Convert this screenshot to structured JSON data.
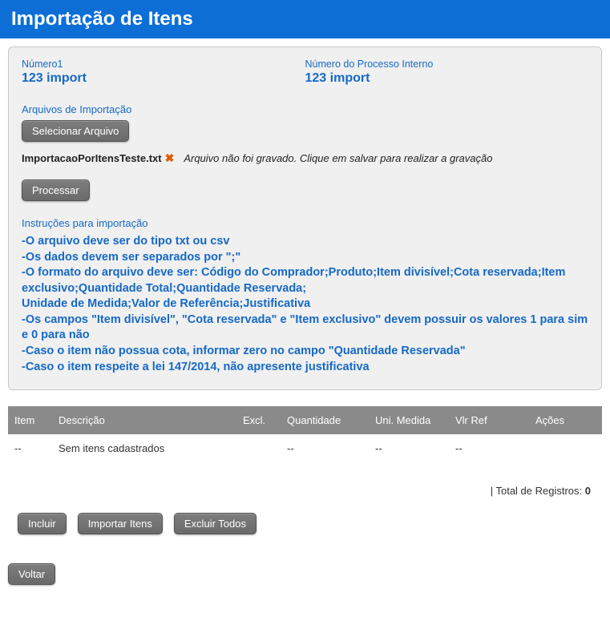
{
  "header": {
    "title": "Importação de Itens"
  },
  "fields": {
    "numero1": {
      "label": "Número1",
      "value": "123 import"
    },
    "numeroProcesso": {
      "label": "Número do Processo Interno",
      "value": "123 import"
    }
  },
  "upload": {
    "sectionLabel": "Arquivos de Importação",
    "selectButton": "Selecionar Arquivo",
    "fileName": "ImportacaoPorItensTeste.txt",
    "deleteIconName": "delete-icon",
    "notSavedMessage": "Arquivo não foi gravado. Clique em salvar para realizar a gravação",
    "processButton": "Processar"
  },
  "instructions": {
    "title": "Instruções para importação",
    "body": "-O arquivo deve ser do tipo txt ou csv\n-Os dados devem ser separados por \";\"\n-O formato do arquivo deve ser: Código do Comprador;Produto;Item divisível;Cota reservada;Item exclusivo;Quantidade Total;Quantidade Reservada;\nUnidade de Medida;Valor de Referência;Justificativa\n-Os campos \"Item divisível\", \"Cota reservada\" e \"Item exclusivo\" devem possuir os valores 1 para sim e 0 para não\n-Caso o item não possua cota, informar zero no campo \"Quantidade Reservada\"\n-Caso o item respeite a lei 147/2014, não apresente justificativa"
  },
  "table": {
    "headers": {
      "item": "Item",
      "descricao": "Descrição",
      "excl": "Excl.",
      "quantidade": "Quantidade",
      "uniMedida": "Uni. Medida",
      "vlrRef": "Vlr Ref",
      "acoes": "Ações"
    },
    "emptyRow": {
      "item": "--",
      "descricao": "Sem itens cadastrados",
      "excl": "",
      "quantidade": "--",
      "uniMedida": "--",
      "vlrRef": "--",
      "acoes": ""
    },
    "totalLabel": "| Total de Registros:",
    "totalCount": "0"
  },
  "buttons": {
    "incluir": "Incluir",
    "importarItens": "Importar Itens",
    "excluirTodos": "Excluir Todos",
    "voltar": "Voltar"
  }
}
